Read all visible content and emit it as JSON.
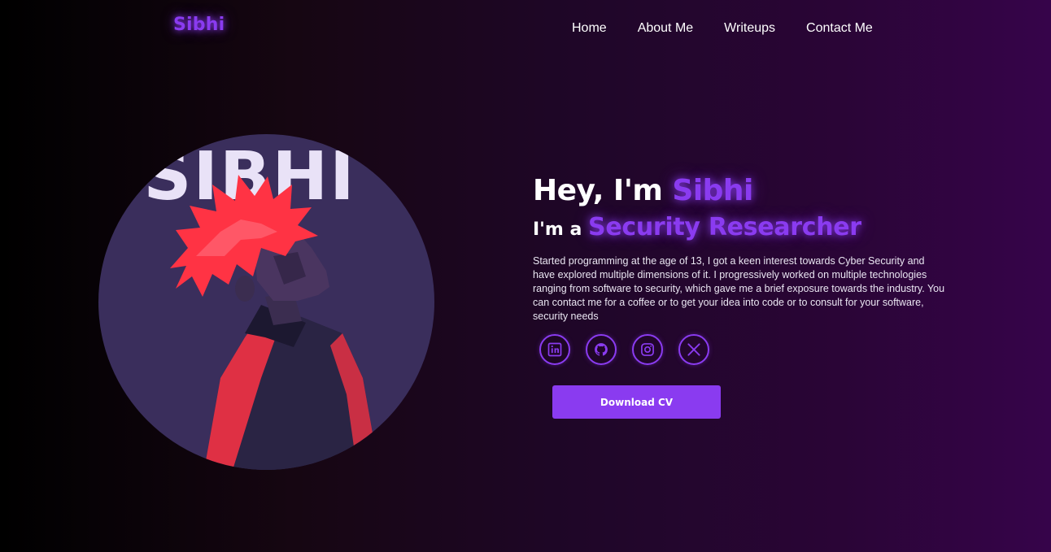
{
  "header": {
    "logo": "Sibhi",
    "nav": [
      "Home",
      "About Me",
      "Writeups",
      "Contact Me"
    ]
  },
  "avatar": {
    "overlay_text": "SIBHI",
    "description": "anime character with spiky red hair"
  },
  "hero": {
    "greeting_prefix": "Hey, I'm ",
    "name": "Sibhi",
    "role_prefix": "I'm a ",
    "role": "Security Researcher",
    "description": "Started programming at the age of 13, I got a keen interest towards Cyber Security and have explored multiple dimensions of it. I progressively worked on multiple technologies ranging from software to security, which gave me a brief exposure towards the industry. You can contact me for a coffee or to get your idea into code or to consult for your software, security needs",
    "socials": [
      "linkedin-icon",
      "github-icon",
      "instagram-icon",
      "x-icon"
    ],
    "cv_button": "Download CV"
  },
  "colors": {
    "accent": "#8a3bf0",
    "avatar_bg": "#3a2e5c",
    "hair": "#ff3344",
    "jacket": "#2a2444"
  }
}
